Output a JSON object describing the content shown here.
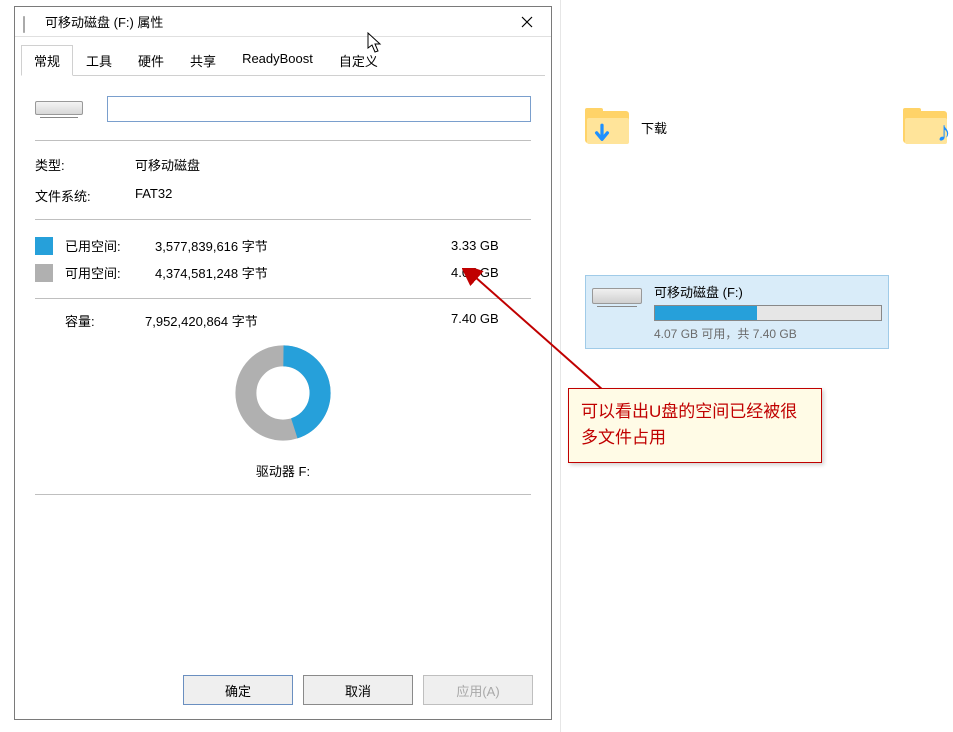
{
  "dialog": {
    "title": "可移动磁盘 (F:) 属性",
    "tabs": [
      "常规",
      "工具",
      "硬件",
      "共享",
      "ReadyBoost",
      "自定义"
    ],
    "typeLabel": "类型:",
    "typeValue": "可移动磁盘",
    "fsLabel": "文件系统:",
    "fsValue": "FAT32",
    "usedLabel": "已用空间:",
    "usedBytes": "3,577,839,616 字节",
    "usedGB": "3.33 GB",
    "freeLabel": "可用空间:",
    "freeBytes": "4,374,581,248 字节",
    "freeGB": "4.07 GB",
    "capacityLabel": "容量:",
    "capacityBytes": "7,952,420,864 字节",
    "capacityGB": "7.40 GB",
    "driveLabel": "驱动器 F:",
    "buttons": {
      "ok": "确定",
      "cancel": "取消",
      "apply": "应用(A)"
    },
    "nameValue": ""
  },
  "explorer": {
    "downloads": "下载",
    "drive": {
      "name": "可移动磁盘 (F:)",
      "capacityText": "4.07 GB 可用，共 7.40 GB"
    }
  },
  "callout": {
    "text": "可以看出U盘的空间已经被很多文件占用"
  },
  "colors": {
    "used": "#26a0da",
    "free": "#b0b0b0",
    "accent": "#c00000"
  },
  "chart_data": {
    "type": "pie",
    "title": "驱动器 F:",
    "series": [
      {
        "name": "已用空间",
        "value": 3.33,
        "color": "#26a0da"
      },
      {
        "name": "可用空间",
        "value": 4.07,
        "color": "#b0b0b0"
      }
    ],
    "unit": "GB",
    "total": 7.4
  }
}
